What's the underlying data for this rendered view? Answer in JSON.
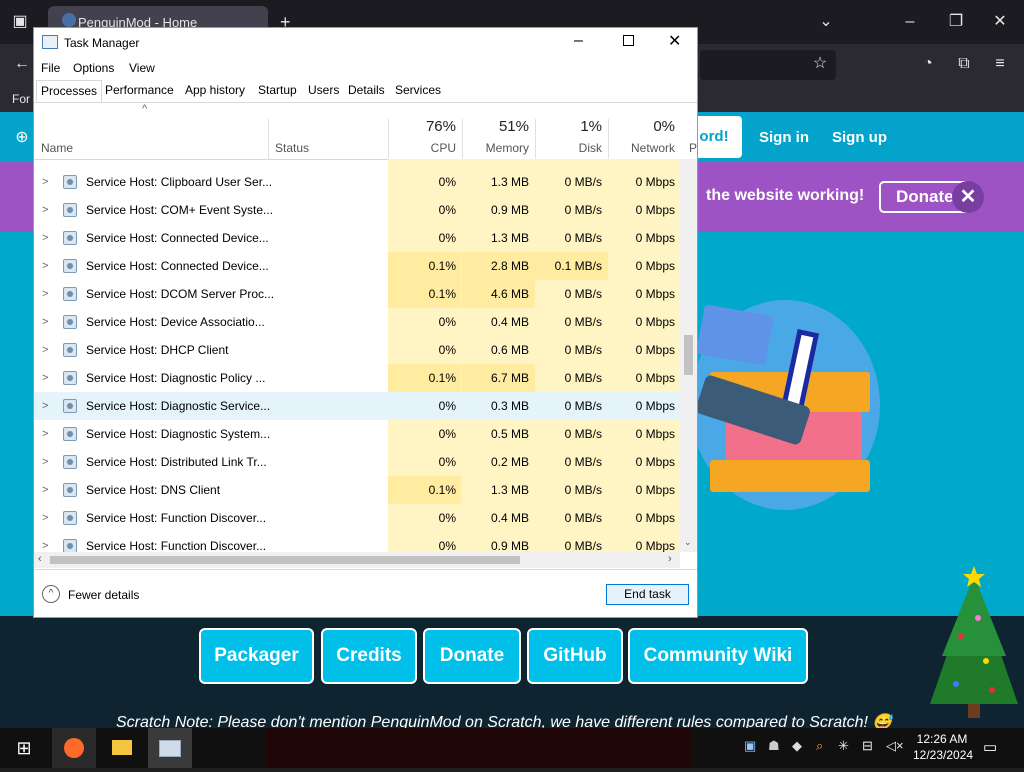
{
  "browser": {
    "tab_title": "PenguinMod - Home",
    "new_tab": "+",
    "bookmark_text": "For"
  },
  "site": {
    "header_links": [
      "ord!",
      "Sign in",
      "Sign up"
    ],
    "banner_text": "the website working!",
    "donate_label": "Donate",
    "close_label": "✕",
    "footer_buttons": [
      "Packager",
      "Credits",
      "Donate",
      "GitHub",
      "Community Wiki"
    ],
    "scratch_note": "Scratch Note: Please don't mention PenguinMod on Scratch, we have different rules compared to Scratch! 😅"
  },
  "task_manager": {
    "title": "Task Manager",
    "menu": [
      "File",
      "Options",
      "View"
    ],
    "tabs": [
      "Processes",
      "Performance",
      "App history",
      "Startup",
      "Users",
      "Details",
      "Services"
    ],
    "active_tab": "Processes",
    "columns": {
      "name": "Name",
      "status": "Status",
      "cpu": {
        "label": "CPU",
        "pct": "76%"
      },
      "memory": {
        "label": "Memory",
        "pct": "51%"
      },
      "disk": {
        "label": "Disk",
        "pct": "1%"
      },
      "network": {
        "label": "Network",
        "pct": "0%"
      },
      "power": "P"
    },
    "rows": [
      {
        "name": "Service Host: Clipboard User Ser...",
        "cpu": "0%",
        "memory": "1.3 MB",
        "disk": "0 MB/s",
        "network": "0 Mbps"
      },
      {
        "name": "Service Host: COM+ Event Syste...",
        "cpu": "0%",
        "memory": "0.9 MB",
        "disk": "0 MB/s",
        "network": "0 Mbps"
      },
      {
        "name": "Service Host: Connected Device...",
        "cpu": "0%",
        "memory": "1.3 MB",
        "disk": "0 MB/s",
        "network": "0 Mbps"
      },
      {
        "name": "Service Host: Connected Device...",
        "cpu": "0.1%",
        "memory": "2.8 MB",
        "disk": "0.1 MB/s",
        "network": "0 Mbps"
      },
      {
        "name": "Service Host: DCOM Server Proc...",
        "cpu": "0.1%",
        "memory": "4.6 MB",
        "disk": "0 MB/s",
        "network": "0 Mbps"
      },
      {
        "name": "Service Host: Device Associatio...",
        "cpu": "0%",
        "memory": "0.4 MB",
        "disk": "0 MB/s",
        "network": "0 Mbps"
      },
      {
        "name": "Service Host: DHCP Client",
        "cpu": "0%",
        "memory": "0.6 MB",
        "disk": "0 MB/s",
        "network": "0 Mbps"
      },
      {
        "name": "Service Host: Diagnostic Policy ...",
        "cpu": "0.1%",
        "memory": "6.7 MB",
        "disk": "0 MB/s",
        "network": "0 Mbps"
      },
      {
        "name": "Service Host: Diagnostic Service...",
        "cpu": "0%",
        "memory": "0.3 MB",
        "disk": "0 MB/s",
        "network": "0 Mbps"
      },
      {
        "name": "Service Host: Diagnostic System...",
        "cpu": "0%",
        "memory": "0.5 MB",
        "disk": "0 MB/s",
        "network": "0 Mbps"
      },
      {
        "name": "Service Host: Distributed Link Tr...",
        "cpu": "0%",
        "memory": "0.2 MB",
        "disk": "0 MB/s",
        "network": "0 Mbps"
      },
      {
        "name": "Service Host: DNS Client",
        "cpu": "0.1%",
        "memory": "1.3 MB",
        "disk": "0 MB/s",
        "network": "0 Mbps"
      },
      {
        "name": "Service Host: Function Discover...",
        "cpu": "0%",
        "memory": "0.4 MB",
        "disk": "0 MB/s",
        "network": "0 Mbps"
      },
      {
        "name": "Service Host: Function Discover...",
        "cpu": "0%",
        "memory": "0.9 MB",
        "disk": "0 MB/s",
        "network": "0 Mbps"
      }
    ],
    "fewer_details": "Fewer details",
    "end_task": "End task"
  },
  "taskbar": {
    "time": "12:26 AM",
    "date": "12/23/2024"
  },
  "colors": {
    "site_blue": "#00a8c9",
    "site_purple": "#9d53c4",
    "heat_light": "#fff4c4",
    "heat_medium": "#ffeca0",
    "selected_row": "#e5f3fb"
  }
}
